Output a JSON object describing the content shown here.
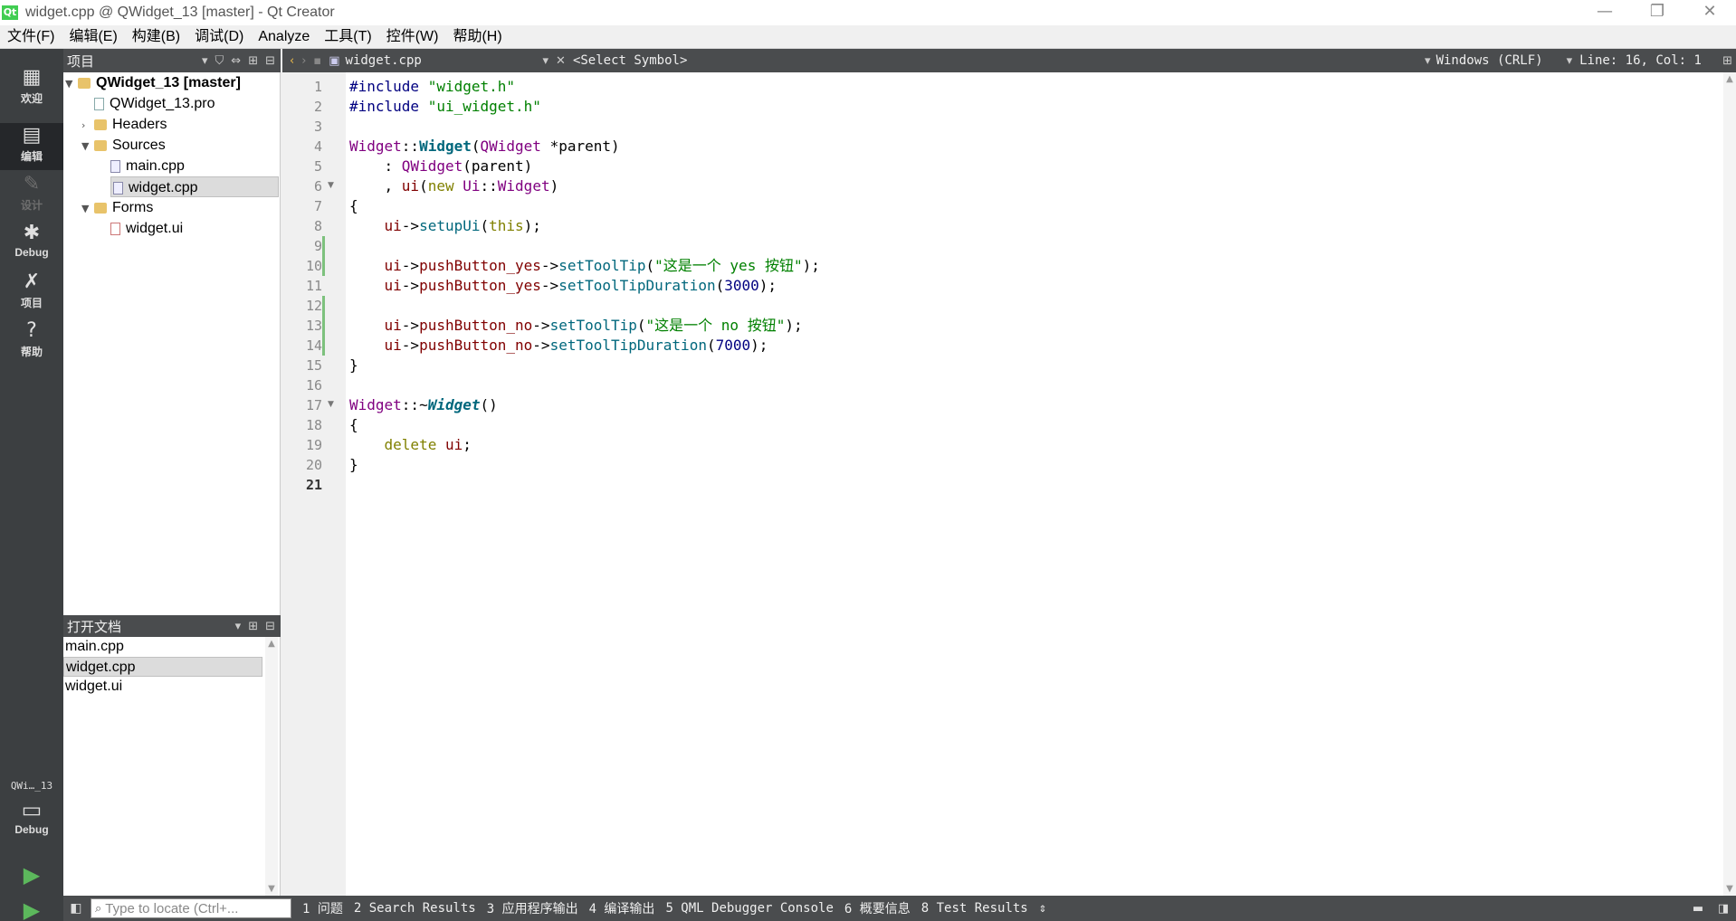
{
  "window": {
    "title": "widget.cpp @ QWidget_13 [master] - Qt Creator",
    "app_icon": "qt-icon",
    "minimize": "—",
    "restore": "❐",
    "close": "✕"
  },
  "menu": [
    "文件(F)",
    "编辑(E)",
    "构建(B)",
    "调试(D)",
    "Analyze",
    "工具(T)",
    "控件(W)",
    "帮助(H)"
  ],
  "modes": [
    {
      "label": "欢迎",
      "icon": "▦",
      "name": "welcome"
    },
    {
      "label": "编辑",
      "icon": "▤",
      "name": "edit"
    },
    {
      "label": "设计",
      "icon": "✎",
      "name": "design"
    },
    {
      "label": "Debug",
      "icon": "✱",
      "name": "debug"
    },
    {
      "label": "项目",
      "icon": "✗",
      "name": "projects"
    },
    {
      "label": "帮助",
      "icon": "?",
      "name": "help"
    }
  ],
  "kit": {
    "label": "QWi…_13",
    "mode": "Debug",
    "icon": "▭"
  },
  "run_icons": {
    "run": "▶",
    "debug_run": "▶",
    "build": "⚒"
  },
  "project_pane": {
    "title": "项目",
    "tree": [
      {
        "label": "QWidget_13 [master]",
        "arrow": "▼",
        "icon": "folder"
      },
      {
        "label": "QWidget_13.pro",
        "arrow": "",
        "icon": "file"
      },
      {
        "label": "Headers",
        "arrow": "›",
        "icon": "folder"
      },
      {
        "label": "Sources",
        "arrow": "▼",
        "icon": "folder"
      },
      {
        "label": "main.cpp",
        "arrow": "",
        "icon": "cpp"
      },
      {
        "label": "widget.cpp",
        "arrow": "",
        "icon": "cpp"
      },
      {
        "label": "Forms",
        "arrow": "▼",
        "icon": "folder"
      },
      {
        "label": "widget.ui",
        "arrow": "",
        "icon": "ui"
      }
    ]
  },
  "open_docs": {
    "title": "打开文档",
    "items": [
      "main.cpp",
      "widget.cpp",
      "widget.ui"
    ]
  },
  "editor_toolbar": {
    "file": "widget.cpp",
    "symbol": "<Select Symbol>",
    "line_ending": "Windows (CRLF)",
    "position": "Line: 16, Col: 1"
  },
  "line_numbers": [
    "1",
    "2",
    "3",
    "4",
    "5",
    "6",
    "7",
    "8",
    "9",
    "10",
    "11",
    "12",
    "13",
    "14",
    "15",
    "16",
    "17",
    "18",
    "19",
    "20",
    "21"
  ],
  "code": {
    "l1": {
      "a": "#include ",
      "b": "\"widget.h\""
    },
    "l2": {
      "a": "#include ",
      "b": "\"ui_widget.h\""
    },
    "l4": {
      "a": "Widget",
      "b": "::",
      "c": "Widget",
      "d": "(",
      "e": "QWidget",
      "f": " *",
      "g": "parent",
      "h": ")"
    },
    "l5": {
      "a": "    : ",
      "b": "QWidget",
      "c": "(",
      "d": "parent",
      "e": ")"
    },
    "l6": {
      "a": "    , ",
      "b": "ui",
      "c": "(",
      "d": "new",
      "e": " ",
      "f": "Ui",
      "g": "::",
      "h": "Widget",
      "i": ")"
    },
    "l7": "{",
    "l8": {
      "a": "    ",
      "b": "ui",
      "c": "->",
      "d": "setupUi",
      "e": "(",
      "f": "this",
      "g": ");"
    },
    "l10": {
      "a": "    ",
      "b": "ui",
      "c": "->",
      "d": "pushButton_yes",
      "e": "->",
      "f": "setToolTip",
      "g": "(",
      "h": "\"这是一个 yes 按钮\"",
      "i": ");"
    },
    "l11": {
      "a": "    ",
      "b": "ui",
      "c": "->",
      "d": "pushButton_yes",
      "e": "->",
      "f": "setToolTipDuration",
      "g": "(",
      "h": "3000",
      "i": ");"
    },
    "l13": {
      "a": "    ",
      "b": "ui",
      "c": "->",
      "d": "pushButton_no",
      "e": "->",
      "f": "setToolTip",
      "g": "(",
      "h": "\"这是一个 no 按钮\"",
      "i": ");"
    },
    "l14": {
      "a": "    ",
      "b": "ui",
      "c": "->",
      "d": "pushButton_no",
      "e": "->",
      "f": "setToolTipDuration",
      "g": "(",
      "h": "7000",
      "i": ");"
    },
    "l15": "}",
    "l17": {
      "a": "Widget",
      "b": "::~",
      "c": "Widget",
      "d": "()"
    },
    "l18": "{",
    "l19": {
      "a": "    ",
      "b": "delete",
      "c": " ",
      "d": "ui",
      "e": ";"
    },
    "l20": "}"
  },
  "status": {
    "locator_placeholder": "Type to locate (Ctrl+...",
    "tabs": [
      "1 问题",
      "2 Search Results",
      "3 应用程序输出",
      "4 编译输出",
      "5 QML Debugger Console",
      "6 概要信息",
      "8 Test Results"
    ]
  },
  "colors": {
    "keyword": "#808000",
    "string": "#008000",
    "type": "#800080",
    "function": "#00677c",
    "member": "#800000",
    "number": "#000080"
  }
}
